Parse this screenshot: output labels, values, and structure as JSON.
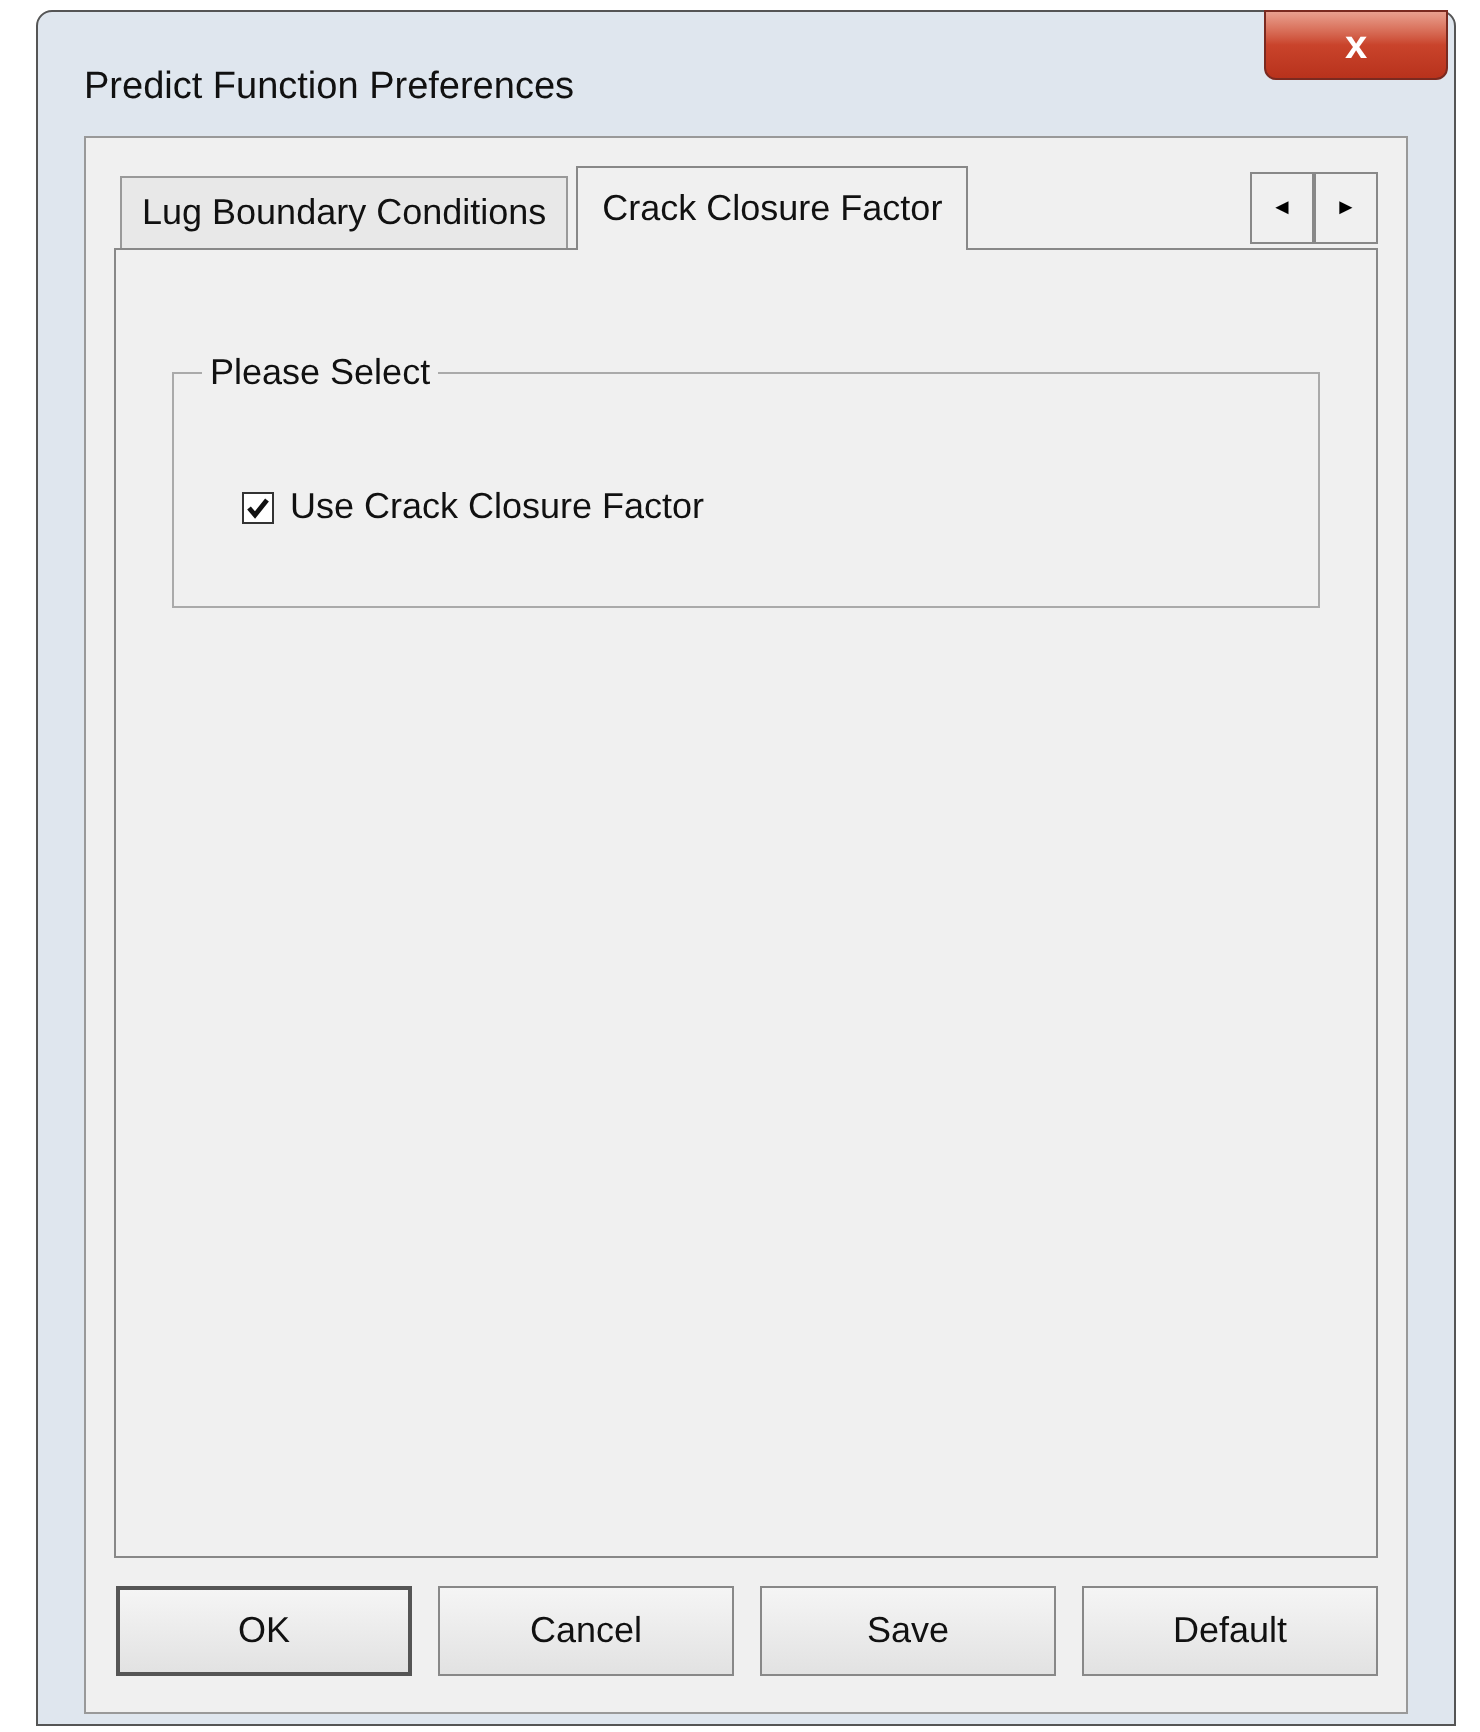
{
  "window": {
    "title": "Predict Function Preferences",
    "close_label": "x"
  },
  "tabs": [
    {
      "label": "Lug Boundary Conditions",
      "selected": false
    },
    {
      "label": "Crack Closure Factor",
      "selected": true
    }
  ],
  "tab_scroll": [
    "◄",
    "►"
  ],
  "group": {
    "title": "Please Select",
    "checkbox": {
      "label": "Use Crack Closure Factor",
      "checked": true
    }
  },
  "buttons": [
    "OK",
    "Cancel",
    "Save",
    "Default"
  ]
}
